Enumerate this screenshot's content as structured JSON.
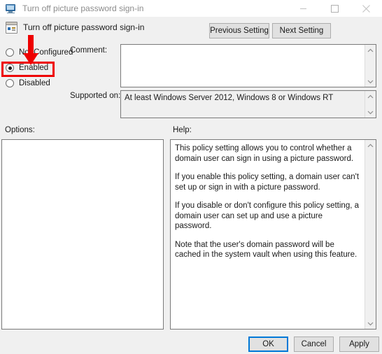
{
  "titlebar": {
    "title": "Turn off picture password sign-in",
    "icon": "monitor-icon",
    "minimize_label": "—",
    "maximize_label": "☐",
    "close_label": "✕"
  },
  "header": {
    "title": "Turn off picture password sign-in",
    "icon": "policy-setting-icon",
    "previous_label": "Previous Setting",
    "next_label": "Next Setting"
  },
  "state_options": [
    {
      "label": "Not Configured",
      "checked": false
    },
    {
      "label": "Enabled",
      "checked": true
    },
    {
      "label": "Disabled",
      "checked": false
    }
  ],
  "comment": {
    "label": "Comment:",
    "value": "",
    "placeholder": ""
  },
  "supported_on": {
    "label": "Supported on:",
    "value": "At least Windows Server 2012, Windows 8 or Windows RT"
  },
  "options": {
    "label": "Options:",
    "content": ""
  },
  "help": {
    "label": "Help:",
    "paragraphs": [
      "This policy setting allows you to control whether a domain user can sign in using a picture password.",
      "If you enable this policy setting, a domain user can't set up or sign in with a picture password.",
      "If you disable or don't configure this policy setting, a domain user can set up and use a picture password.",
      "Note that the user's domain password will be cached in the system vault when using this feature."
    ]
  },
  "footer": {
    "ok_label": "OK",
    "cancel_label": "Cancel",
    "apply_label": "Apply"
  },
  "annotation": {
    "color": "#ee0000",
    "highlighted_option": "Enabled"
  },
  "colors": {
    "window_background": "#f0f0f0",
    "titlebar_background": "#ffffff",
    "field_background": "#ffffff",
    "accent": "#0078d7",
    "annotation_red": "#ee0000"
  }
}
